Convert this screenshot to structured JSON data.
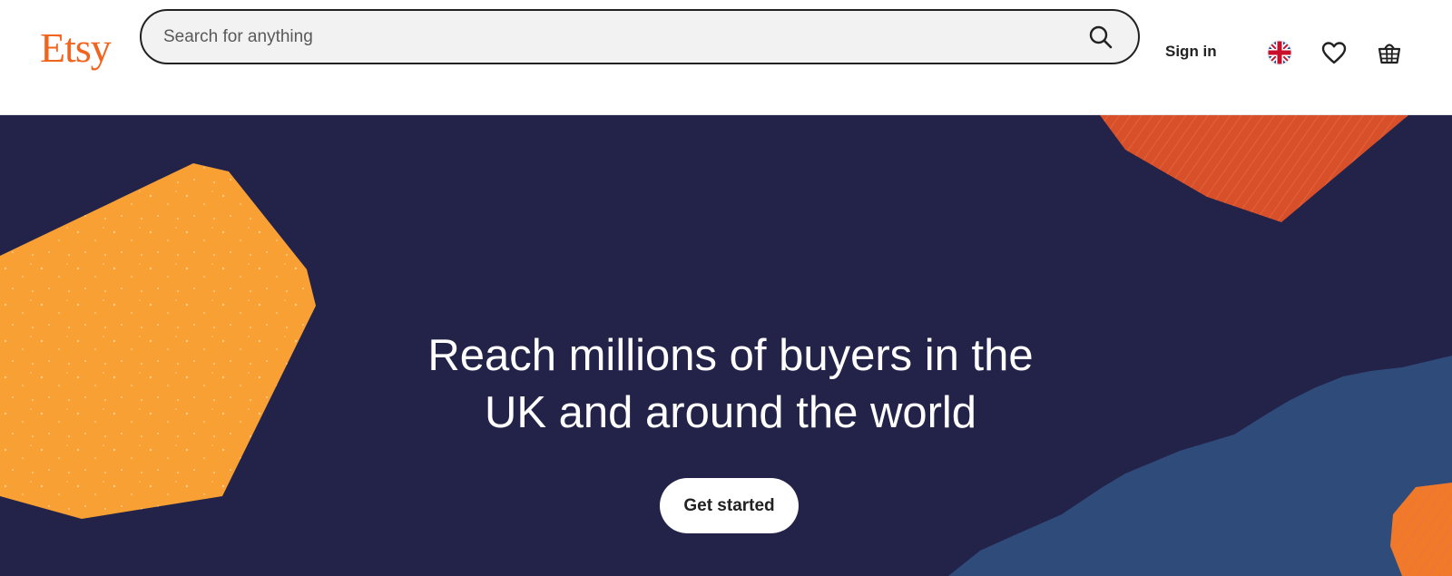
{
  "header": {
    "logo": "Etsy",
    "search": {
      "placeholder": "Search for anything",
      "value": ""
    },
    "sign_in_label": "Sign in",
    "icons": [
      "search-icon",
      "uk-flag-icon",
      "heart-icon",
      "basket-icon"
    ]
  },
  "hero": {
    "headline_line1": "Reach millions of buyers in the",
    "headline_line2": "UK and around the world",
    "cta_label": "Get started"
  },
  "colors": {
    "brand": "#f1641e",
    "hero_bg": "#23234a",
    "shape_yellow": "#f8a033",
    "shape_orange": "#d8502a",
    "shape_blue": "#2f4b7a"
  }
}
